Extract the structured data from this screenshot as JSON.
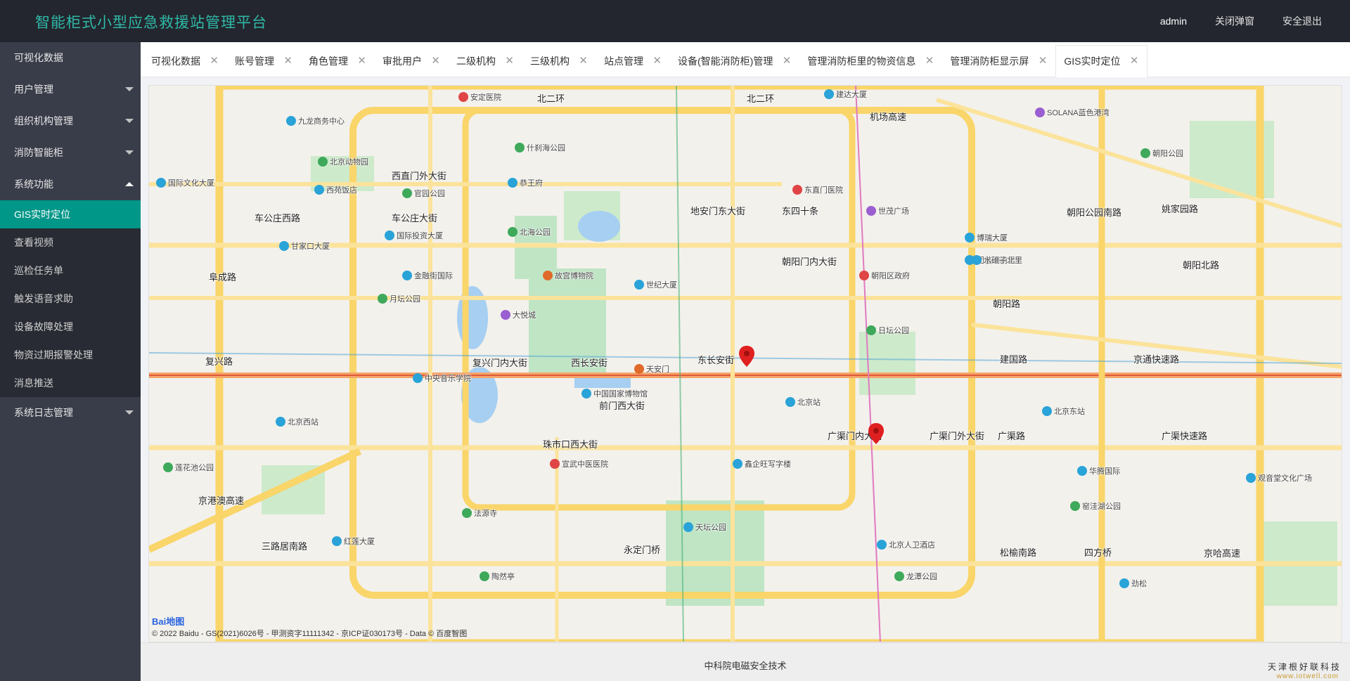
{
  "header": {
    "title": "智能柜式小型应急救援站管理平台",
    "user": "admin",
    "close_popup": "关闭弹窗",
    "logout": "安全退出"
  },
  "sidebar": {
    "items": [
      {
        "label": "可视化数据"
      },
      {
        "label": "用户管理"
      },
      {
        "label": "组织机构管理"
      },
      {
        "label": "消防智能柜"
      },
      {
        "label": "系统功能"
      },
      {
        "label": "系统日志管理"
      }
    ],
    "system_sub": [
      {
        "label": "GIS实时定位"
      },
      {
        "label": "查看视频"
      },
      {
        "label": "巡检任务单"
      },
      {
        "label": "触发语音求助"
      },
      {
        "label": "设备故障处理"
      },
      {
        "label": "物资过期报警处理"
      },
      {
        "label": "消息推送"
      }
    ]
  },
  "tabs": [
    {
      "label": "可视化数据"
    },
    {
      "label": "账号管理"
    },
    {
      "label": "角色管理"
    },
    {
      "label": "审批用户"
    },
    {
      "label": "二级机构"
    },
    {
      "label": "三级机构"
    },
    {
      "label": "站点管理"
    },
    {
      "label": "设备(智能消防柜)管理"
    },
    {
      "label": "管理消防柜里的物资信息"
    },
    {
      "label": "管理消防柜显示屏"
    },
    {
      "label": "GIS实时定位"
    }
  ],
  "map": {
    "labels": {
      "l1": "北二环",
      "l2": "北二环",
      "l3": "车公庄西路",
      "l4": "车公庄大街",
      "l5": "地安门东大街",
      "l6": "东四十条",
      "l7": "阜成路",
      "l8": "复兴路",
      "l9": "复兴门内大街",
      "l10": "西长安街",
      "l11": "东长安街",
      "l12": "建国路",
      "l13": "京通快速路",
      "l14": "广渠门内大街",
      "l15": "广渠门外大街",
      "l16": "广渠快速路",
      "l17": "珠市口西大街",
      "l18": "三路居南路",
      "l19": "永定门桥",
      "l20": "松榆南路",
      "l21": "京哈高速",
      "l22": "朝阳公园南路",
      "l23": "朝阳北路",
      "l24": "机场高速",
      "l25": "朝阳门内大街",
      "l26": "前门西大街",
      "l27": "京港澳高速",
      "l28": "西直门外大街",
      "l29": "姚家园路",
      "l30": "朝阳路",
      "l31": "四方桥",
      "l32": "广渠路"
    },
    "pois": {
      "p1": "九龙商务中心",
      "p2": "北京动物园",
      "p3": "西苑饭店",
      "p4": "国际文化大厦",
      "p5": "官园公园",
      "p6": "国际投资大厦",
      "p7": "甘家口大厦",
      "p8": "金融街国际",
      "p9": "月坛公园",
      "p10": "大悦城",
      "p11": "故宫博物院",
      "p12": "北海公园",
      "p13": "恭王府",
      "p14": "什刹海公园",
      "p15": "世纪大厦",
      "p16": "中国国家博物馆",
      "p17": "北京站",
      "p18": "东直门医院",
      "p19": "世茂广场",
      "p20": "朝阳区政府",
      "p21": "日坛公园",
      "p22": "团结湖南里",
      "p23": "博瑞大厦",
      "p24": "朝阳公园",
      "p25": "中央音乐学院",
      "p26": "北京西站",
      "p27": "宣武中医医院",
      "p28": "天坛公园",
      "p29": "鑫企旺写字楼",
      "p30": "北京人卫酒店",
      "p31": "华腾国际",
      "p32": "观音堂文化广场",
      "p33": "窑洼湖公园",
      "p34": "北京东站",
      "p35": "天安门",
      "p36": "莲花池公园",
      "p37": "红莲大厦",
      "p38": "法源寺",
      "p39": "陶然亭",
      "p40": "龙潭公园",
      "p41": "劲松",
      "p42": "SOLANA蓝色港湾",
      "p43": "安定医院",
      "p44": "建达大厦",
      "p45": "水碓子北里"
    },
    "copyright": "© 2022 Baidu - GS(2021)6026号 - 甲测资字11111342 - 京ICP证030173号 - Data © 百度智图",
    "logo_text": "Bai",
    "logo_text2": "地图"
  },
  "footer": {
    "text": "中科院电磁安全技术",
    "brand": "天津根好联科技",
    "url": "www.iotwell.com"
  },
  "colors": {
    "accent": "#009688",
    "header_bg": "#23262e",
    "sidebar_bg": "#393d49",
    "title_color": "#2fb8a7",
    "marker": "#e02020"
  }
}
